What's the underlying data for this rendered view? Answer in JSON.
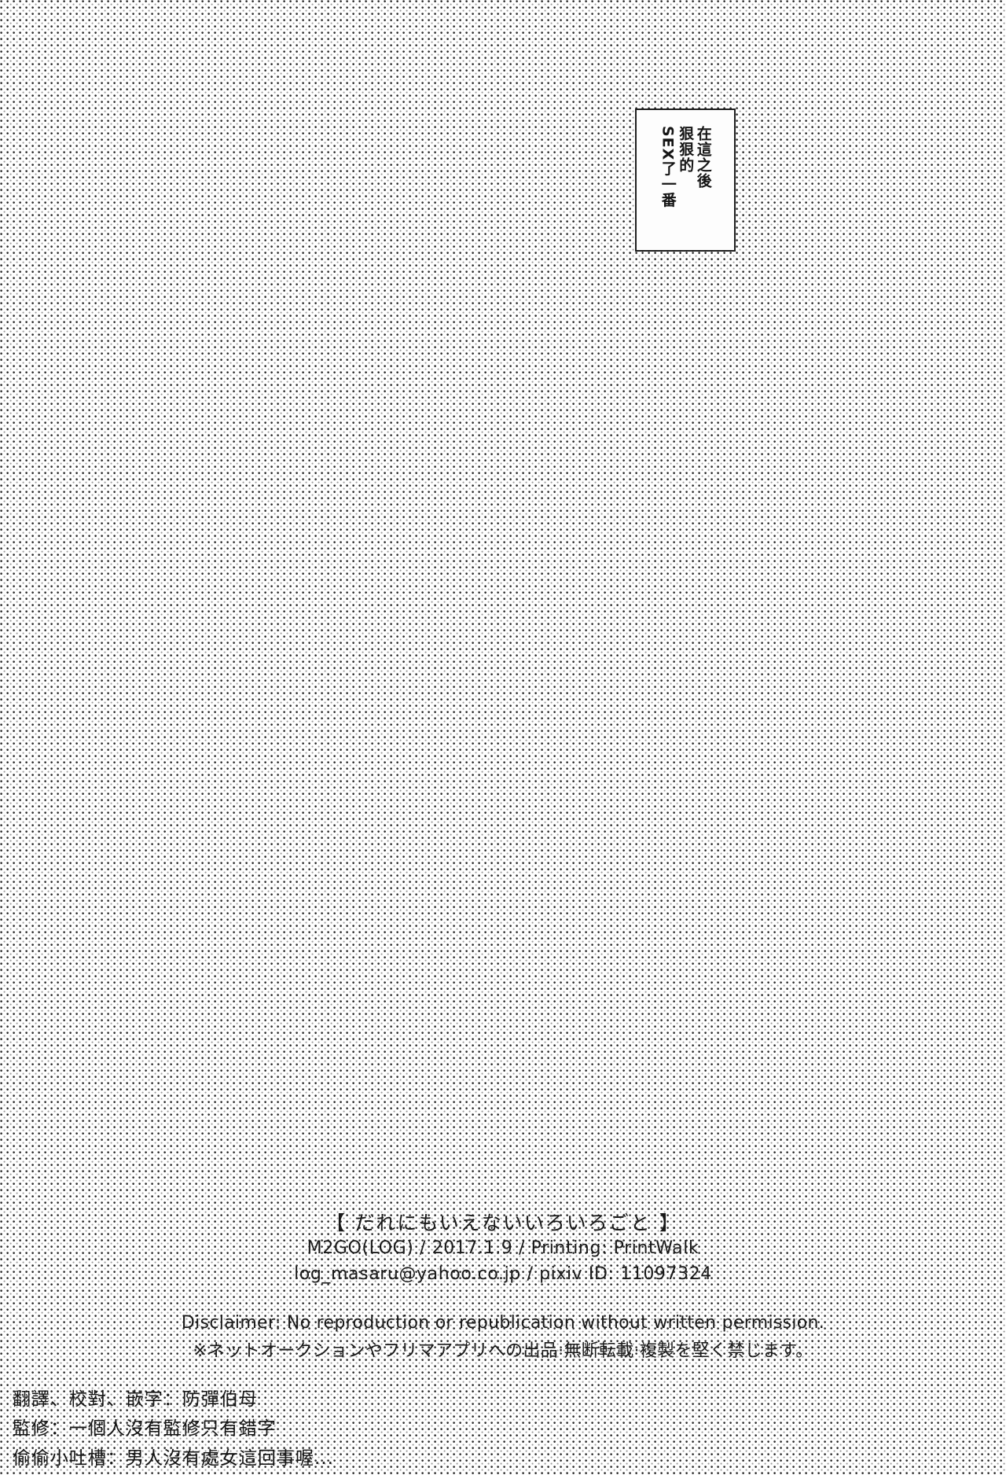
{
  "page": {
    "background_color": "#fefefe",
    "tone_dot_color": "#2b2b2b",
    "ink_color": "#191919"
  },
  "narration_box": {
    "border_color": "#1f1f1f",
    "fill_color": "#fdfdfd",
    "columns": [
      {
        "text": "在這之後"
      },
      {
        "text": "狠狠的"
      },
      {
        "text": "SEX了一番"
      }
    ]
  },
  "colophon": {
    "title": "【 だれにもいえないいろいろごと 】",
    "circle_line": "M2GO(LOG) / 2017.1.9 / Printing: PrintWalk",
    "contact_line": "log_masaru@yahoo.co.jp / pixiv ID: 11097324"
  },
  "disclaimer": {
    "english": "Disclaimer: No reproduction or republication without written permission.",
    "japanese": "※ネットオークションやフリマアプリへの出品·無断転載·複製を堅く禁じます。"
  },
  "translation_notes": {
    "lines": [
      "翻譯、校對、嵌字：防彈伯母",
      "監修：一個人沒有監修只有錯字",
      "偷偷小吐槽：男人沒有處女這回事喔..."
    ]
  }
}
